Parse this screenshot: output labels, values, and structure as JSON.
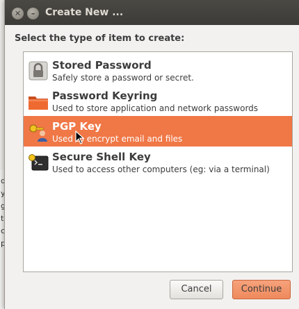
{
  "dialog": {
    "title": "Create New ...",
    "prompt": "Select the type of item to create:"
  },
  "items": [
    {
      "name": "Stored Password",
      "description": "Safely store a password or secret.",
      "icon": "lock-icon"
    },
    {
      "name": "Password Keyring",
      "description": "Used to store application and network passwords",
      "icon": "folder-icon"
    },
    {
      "name": "PGP Key",
      "description": "Used to encrypt email and files",
      "icon": "pgp-key-icon",
      "selected": true
    },
    {
      "name": "Secure Shell Key",
      "description": "Used to access other computers (eg: via a terminal)",
      "icon": "terminal-key-icon"
    }
  ],
  "buttons": {
    "cancel": "Cancel",
    "continue": "Continue"
  },
  "background_window": {
    "letters": [
      "d",
      "y",
      "g",
      "t",
      "c",
      "p"
    ]
  },
  "colors": {
    "selection": "#f07746",
    "titlebar": "#3c3b37",
    "continue_button": "#ef8a5c"
  }
}
